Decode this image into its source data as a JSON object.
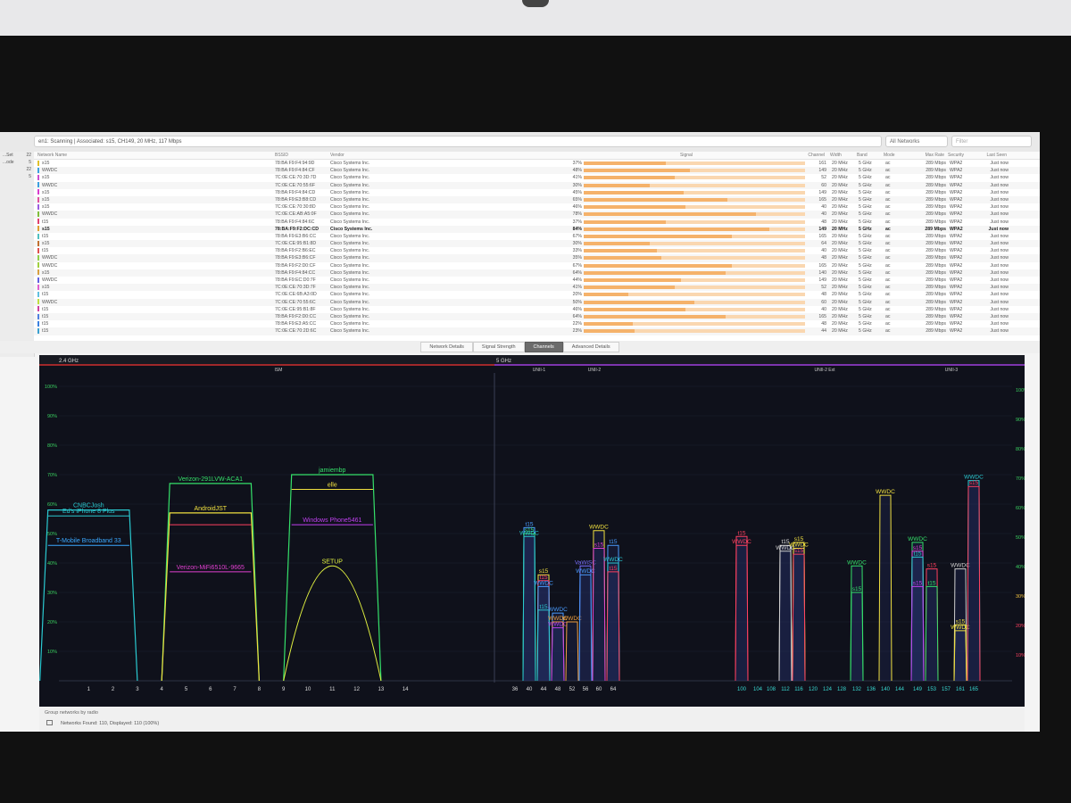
{
  "toolbar": {
    "status": "en1: Scanning | Associated: s15, CH149, 20 MHz, 117 Mbps",
    "filter": "All Networks",
    "search_placeholder": "Filter"
  },
  "sidebar": [
    {
      "label": "...Set",
      "count": "22"
    },
    {
      "label": "...ode",
      "count": "5"
    },
    {
      "label": "",
      "count": "22"
    },
    {
      "label": "",
      "count": "5"
    }
  ],
  "table": {
    "columns": [
      "Network Name",
      "BSSID",
      "Vendor",
      "Signal",
      "Channel",
      "Width",
      "Band",
      "Mode",
      "Max Rate",
      "Security",
      "Last Seen"
    ],
    "rows": [
      {
        "ssid": "s15",
        "color": "#e0c02a",
        "bssid": "78:BA:F9:F4:94:9D",
        "vendor": "Cisco Systems Inc.",
        "pct": "37%",
        "signal": 0.37,
        "channel": "161",
        "width": "20 MHz",
        "band": "5 GHz",
        "mode": "ac",
        "rate": "289 Mbps",
        "security": "WPA2",
        "seen": "Just now",
        "bold": false
      },
      {
        "ssid": "WWDC",
        "color": "#3aa0e0",
        "bssid": "78:BA:F9:F4:84:CF",
        "vendor": "Cisco Systems Inc.",
        "pct": "48%",
        "signal": 0.48,
        "channel": "149",
        "width": "20 MHz",
        "band": "5 GHz",
        "mode": "ac",
        "rate": "289 Mbps",
        "security": "WPA2",
        "seen": "Just now",
        "bold": false
      },
      {
        "ssid": "s15",
        "color": "#cc4fd0",
        "bssid": "7C:0E:CE:70:3D:7D",
        "vendor": "Cisco Systems Inc.",
        "pct": "41%",
        "signal": 0.41,
        "channel": "52",
        "width": "20 MHz",
        "band": "5 GHz",
        "mode": "ac",
        "rate": "289 Mbps",
        "security": "WPA2",
        "seen": "Just now",
        "bold": false
      },
      {
        "ssid": "WWDC",
        "color": "#3aa0e0",
        "bssid": "7C:0E:CE:70:55:6F",
        "vendor": "Cisco Systems Inc.",
        "pct": "30%",
        "signal": 0.3,
        "channel": "60",
        "width": "20 MHz",
        "band": "5 GHz",
        "mode": "ac",
        "rate": "289 Mbps",
        "security": "WPA2",
        "seen": "Just now",
        "bold": false
      },
      {
        "ssid": "s15",
        "color": "#d83bd0",
        "bssid": "78:BA:F9:F4:84:CD",
        "vendor": "Cisco Systems Inc.",
        "pct": "45%",
        "signal": 0.45,
        "channel": "149",
        "width": "20 MHz",
        "band": "5 GHz",
        "mode": "ac",
        "rate": "289 Mbps",
        "security": "WPA2",
        "seen": "Just now",
        "bold": false
      },
      {
        "ssid": "s15",
        "color": "#e050a0",
        "bssid": "78:BA:F9:E3:B8:CD",
        "vendor": "Cisco Systems Inc.",
        "pct": "65%",
        "signal": 0.65,
        "channel": "165",
        "width": "20 MHz",
        "band": "5 GHz",
        "mode": "ac",
        "rate": "289 Mbps",
        "security": "WPA2",
        "seen": "Just now",
        "bold": false
      },
      {
        "ssid": "s15",
        "color": "#9a5ce0",
        "bssid": "7C:0E:CE:70:30:8D",
        "vendor": "Cisco Systems Inc.",
        "pct": "46%",
        "signal": 0.46,
        "channel": "40",
        "width": "20 MHz",
        "band": "5 GHz",
        "mode": "ac",
        "rate": "289 Mbps",
        "security": "WPA2",
        "seen": "Just now",
        "bold": false
      },
      {
        "ssid": "WWDC",
        "color": "#7fbf3a",
        "bssid": "7C:0E:CE:AB:A5:0F",
        "vendor": "Cisco Systems Inc.",
        "pct": "78%",
        "signal": 0.78,
        "channel": "40",
        "width": "20 MHz",
        "band": "5 GHz",
        "mode": "ac",
        "rate": "289 Mbps",
        "security": "WPA2",
        "seen": "Just now",
        "bold": false
      },
      {
        "ssid": "t15",
        "color": "#e04070",
        "bssid": "78:BA:F9:F4:84:6C",
        "vendor": "Cisco Systems Inc.",
        "pct": "37%",
        "signal": 0.37,
        "channel": "48",
        "width": "20 MHz",
        "band": "5 GHz",
        "mode": "ac",
        "rate": "289 Mbps",
        "security": "WPA2",
        "seen": "Just now",
        "bold": false
      },
      {
        "ssid": "s15",
        "color": "#e0a030",
        "bssid": "78:BA:F9:F2:DC:CD",
        "vendor": "Cisco Systems Inc.",
        "pct": "84%",
        "signal": 0.84,
        "channel": "149",
        "width": "20 MHz",
        "band": "5 GHz",
        "mode": "ac",
        "rate": "289 Mbps",
        "security": "WPA2",
        "seen": "Just now",
        "bold": true
      },
      {
        "ssid": "t15",
        "color": "#50c0c0",
        "bssid": "78:BA:F9:E3:B6:CC",
        "vendor": "Cisco Systems Inc.",
        "pct": "67%",
        "signal": 0.67,
        "channel": "165",
        "width": "20 MHz",
        "band": "5 GHz",
        "mode": "ac",
        "rate": "289 Mbps",
        "security": "WPA2",
        "seen": "Just now",
        "bold": false
      },
      {
        "ssid": "s15",
        "color": "#c07030",
        "bssid": "7C:0E:CE:95:B1:8D",
        "vendor": "Cisco Systems Inc.",
        "pct": "30%",
        "signal": 0.3,
        "channel": "64",
        "width": "20 MHz",
        "band": "5 GHz",
        "mode": "ac",
        "rate": "289 Mbps",
        "security": "WPA2",
        "seen": "Just now",
        "bold": false
      },
      {
        "ssid": "t15",
        "color": "#e05050",
        "bssid": "78:BA:F9:F2:B6:EC",
        "vendor": "Cisco Systems Inc.",
        "pct": "33%",
        "signal": 0.33,
        "channel": "40",
        "width": "20 MHz",
        "band": "5 GHz",
        "mode": "ac",
        "rate": "289 Mbps",
        "security": "WPA2",
        "seen": "Just now",
        "bold": false
      },
      {
        "ssid": "WWDC",
        "color": "#8fd04a",
        "bssid": "78:BA:F9:E3:B6:CF",
        "vendor": "Cisco Systems Inc.",
        "pct": "35%",
        "signal": 0.35,
        "channel": "48",
        "width": "20 MHz",
        "band": "5 GHz",
        "mode": "ac",
        "rate": "289 Mbps",
        "security": "WPA2",
        "seen": "Just now",
        "bold": false
      },
      {
        "ssid": "WWDC",
        "color": "#a0d040",
        "bssid": "78:BA:F9:F2:D0:CF",
        "vendor": "Cisco Systems Inc.",
        "pct": "67%",
        "signal": 0.67,
        "channel": "165",
        "width": "20 MHz",
        "band": "5 GHz",
        "mode": "ac",
        "rate": "289 Mbps",
        "security": "WPA2",
        "seen": "Just now",
        "bold": false
      },
      {
        "ssid": "s15",
        "color": "#d8a040",
        "bssid": "78:BA:F9:F4:84:CC",
        "vendor": "Cisco Systems Inc.",
        "pct": "64%",
        "signal": 0.64,
        "channel": "140",
        "width": "20 MHz",
        "band": "5 GHz",
        "mode": "ac",
        "rate": "289 Mbps",
        "security": "WPA2",
        "seen": "Just now",
        "bold": false
      },
      {
        "ssid": "WWDC",
        "color": "#6060e0",
        "bssid": "78:BA:F9:EC:D0:7F",
        "vendor": "Cisco Systems Inc.",
        "pct": "44%",
        "signal": 0.44,
        "channel": "149",
        "width": "20 MHz",
        "band": "5 GHz",
        "mode": "ac",
        "rate": "289 Mbps",
        "security": "WPA2",
        "seen": "Just now",
        "bold": false
      },
      {
        "ssid": "s15",
        "color": "#e060d0",
        "bssid": "7C:0E:CE:70:3D:7F",
        "vendor": "Cisco Systems Inc.",
        "pct": "41%",
        "signal": 0.41,
        "channel": "52",
        "width": "20 MHz",
        "band": "5 GHz",
        "mode": "ac",
        "rate": "289 Mbps",
        "security": "WPA2",
        "seen": "Just now",
        "bold": false
      },
      {
        "ssid": "t15",
        "color": "#60c0e0",
        "bssid": "7C:0E:CE:6B:A3:0D",
        "vendor": "Cisco Systems Inc.",
        "pct": "20%",
        "signal": 0.2,
        "channel": "48",
        "width": "20 MHz",
        "band": "5 GHz",
        "mode": "ac",
        "rate": "289 Mbps",
        "security": "WPA2",
        "seen": "Just now",
        "bold": false
      },
      {
        "ssid": "WWDC",
        "color": "#c0e040",
        "bssid": "7C:0E:CE:70:55:6C",
        "vendor": "Cisco Systems Inc.",
        "pct": "50%",
        "signal": 0.5,
        "channel": "60",
        "width": "20 MHz",
        "band": "5 GHz",
        "mode": "ac",
        "rate": "289 Mbps",
        "security": "WPA2",
        "seen": "Just now",
        "bold": false
      },
      {
        "ssid": "t15",
        "color": "#d040a0",
        "bssid": "7C:0E:CE:95:B1:8F",
        "vendor": "Cisco Systems Inc.",
        "pct": "46%",
        "signal": 0.46,
        "channel": "40",
        "width": "20 MHz",
        "band": "5 GHz",
        "mode": "ac",
        "rate": "289 Mbps",
        "security": "WPA2",
        "seen": "Just now",
        "bold": false
      },
      {
        "ssid": "t15",
        "color": "#5080e0",
        "bssid": "78:BA:F9:F2:D0:CC",
        "vendor": "Cisco Systems Inc.",
        "pct": "64%",
        "signal": 0.64,
        "channel": "165",
        "width": "20 MHz",
        "band": "5 GHz",
        "mode": "ac",
        "rate": "289 Mbps",
        "security": "WPA2",
        "seen": "Just now",
        "bold": false
      },
      {
        "ssid": "t15",
        "color": "#3a80e0",
        "bssid": "78:BA:F9:E3:A5:CC",
        "vendor": "Cisco Systems Inc.",
        "pct": "22%",
        "signal": 0.22,
        "channel": "48",
        "width": "20 MHz",
        "band": "5 GHz",
        "mode": "ac",
        "rate": "289 Mbps",
        "security": "WPA2",
        "seen": "Just now",
        "bold": false
      },
      {
        "ssid": "t15",
        "color": "#3aa0d0",
        "bssid": "7C:0E:CE:70:2D:6C",
        "vendor": "Cisco Systems Inc.",
        "pct": "23%",
        "signal": 0.23,
        "channel": "44",
        "width": "20 MHz",
        "band": "5 GHz",
        "mode": "ac",
        "rate": "289 Mbps",
        "security": "WPA2",
        "seen": "Just now",
        "bold": false
      }
    ]
  },
  "tabs": [
    "Network Details",
    "Signal Strength",
    "Channels",
    "Advanced Details"
  ],
  "active_tab": "Channels",
  "chart_data": [
    {
      "type": "area",
      "title": "2.4 GHz",
      "band_label": "ISM",
      "x_ticks": [
        "1",
        "2",
        "3",
        "4",
        "5",
        "6",
        "7",
        "8",
        "9",
        "10",
        "11",
        "12",
        "13",
        "14"
      ],
      "y_ticks": [
        "100%",
        "90%",
        "80%",
        "70%",
        "60%",
        "50%",
        "40%",
        "30%",
        "20%",
        "10%"
      ],
      "ylim": [
        0,
        100
      ],
      "series": [
        {
          "name": "CNBCJosh",
          "color": "#2ac9d0",
          "from": -1,
          "to": 3,
          "value": 58,
          "shape": "trap"
        },
        {
          "name": "Ed's iPhone 8 Plus",
          "color": "#2ac9d0",
          "from": -1,
          "to": 3,
          "value": 56,
          "shape": "line"
        },
        {
          "name": "T-Mobile Broadband 33",
          "color": "#3aa8ff",
          "from": -1,
          "to": 3,
          "value": 46,
          "shape": "line"
        },
        {
          "name": "Verizon-291LVW-ACA1",
          "color": "#35e06a",
          "from": 4,
          "to": 8,
          "value": 67,
          "shape": "trap"
        },
        {
          "name": "AndroidJST",
          "color": "#f0e040",
          "from": 4,
          "to": 8,
          "value": 57,
          "shape": "trap"
        },
        {
          "name": "",
          "color": "#ff4060",
          "from": 4,
          "to": 8,
          "value": 53,
          "shape": "line"
        },
        {
          "name": "Verizon-MiFi6510L-9665",
          "color": "#e040d0",
          "from": 4,
          "to": 8,
          "value": 37,
          "shape": "line"
        },
        {
          "name": "jamiembp",
          "color": "#35e06a",
          "from": 9,
          "to": 13,
          "value": 70,
          "shape": "trap"
        },
        {
          "name": "elle",
          "color": "#f0e040",
          "from": 9,
          "to": 13,
          "value": 65,
          "shape": "line"
        },
        {
          "name": "Windows Phone5461",
          "color": "#c040f0",
          "from": 9,
          "to": 13,
          "value": 53,
          "shape": "line"
        },
        {
          "name": "SETUP",
          "color": "#e0f040",
          "from": 9,
          "to": 13,
          "value": 39,
          "shape": "arc"
        }
      ]
    },
    {
      "type": "bar",
      "title": "5 GHz",
      "bands": [
        "UNII-1",
        "UNII-2",
        "UNII-2 Ext",
        "UNII-3"
      ],
      "x_ticks": [
        "36",
        "40",
        "44",
        "48",
        "52",
        "56",
        "60",
        "64",
        "100",
        "104",
        "108",
        "112",
        "116",
        "120",
        "124",
        "128",
        "132",
        "136",
        "140",
        "144",
        "149",
        "153",
        "157",
        "161",
        "165"
      ],
      "y_ticks": [
        "100%",
        "90%",
        "80%",
        "70%",
        "60%",
        "50%",
        "40%",
        "30%",
        "20%",
        "10%"
      ],
      "ylim": [
        0,
        100
      ],
      "series": [
        {
          "name": "t15",
          "channel": "40",
          "value": 52,
          "color": "#4a9cff"
        },
        {
          "name": "s15",
          "channel": "40",
          "value": 50,
          "color": "#35e06a"
        },
        {
          "name": "WWDC",
          "channel": "40",
          "value": 49,
          "color": "#2ac9d0"
        },
        {
          "name": "s15",
          "channel": "44",
          "value": 36,
          "color": "#f0e040"
        },
        {
          "name": "t15",
          "channel": "44",
          "value": 34,
          "color": "#ff4060"
        },
        {
          "name": "WWDC",
          "channel": "44",
          "value": 32,
          "color": "#4a9cff"
        },
        {
          "name": "t15",
          "channel": "44",
          "value": 24,
          "color": "#2ac9d0"
        },
        {
          "name": "WWDC",
          "channel": "48",
          "value": 23,
          "color": "#4a9cff"
        },
        {
          "name": "WWDC",
          "channel": "48",
          "value": 20,
          "color": "#f0a040"
        },
        {
          "name": "WWDC",
          "channel": "48",
          "value": 18,
          "color": "#c040f0"
        },
        {
          "name": "WWDC",
          "channel": "52",
          "value": 20,
          "color": "#f0a040"
        },
        {
          "name": "VaWiSC",
          "channel": "56",
          "value": 39,
          "color": "#7a70ff"
        },
        {
          "name": "WWDC",
          "channel": "56",
          "value": 36,
          "color": "#4a9cff"
        },
        {
          "name": "WWDC",
          "channel": "60",
          "value": 51,
          "color": "#f0e040"
        },
        {
          "name": "s15",
          "channel": "60",
          "value": 45,
          "color": "#e040d0"
        },
        {
          "name": "t15",
          "channel": "64",
          "value": 46,
          "color": "#4a9cff"
        },
        {
          "name": "WWDC",
          "channel": "64",
          "value": 40,
          "color": "#2ac9d0"
        },
        {
          "name": "t15",
          "channel": "64",
          "value": 37,
          "color": "#ff4060"
        },
        {
          "name": "t15",
          "channel": "100",
          "value": 49,
          "color": "#ff4060"
        },
        {
          "name": "WWDC",
          "channel": "100",
          "value": 46,
          "color": "#ff4060"
        },
        {
          "name": "t15",
          "channel": "112",
          "value": 46,
          "color": "#e0e0e0"
        },
        {
          "name": "WWDC",
          "channel": "112",
          "value": 44,
          "color": "#d0d0d0"
        },
        {
          "name": "s15",
          "channel": "116",
          "value": 47,
          "color": "#f0e040"
        },
        {
          "name": "WWDC",
          "channel": "116",
          "value": 45,
          "color": "#f0e040"
        },
        {
          "name": "s15",
          "channel": "116",
          "value": 43,
          "color": "#ff4060"
        },
        {
          "name": "WWDC",
          "channel": "132",
          "value": 39,
          "color": "#35e06a"
        },
        {
          "name": "s15",
          "channel": "132",
          "value": 30,
          "color": "#35e06a"
        },
        {
          "name": "WWDC",
          "channel": "140",
          "value": 63,
          "color": "#f0e040"
        },
        {
          "name": "WWDC",
          "channel": "149",
          "value": 47,
          "color": "#35e06a"
        },
        {
          "name": "s15",
          "channel": "149",
          "value": 44,
          "color": "#e040d0"
        },
        {
          "name": "t15",
          "channel": "149",
          "value": 42,
          "color": "#2ac9d0"
        },
        {
          "name": "s15",
          "channel": "153",
          "value": 38,
          "color": "#ff4060"
        },
        {
          "name": "s15",
          "channel": "149",
          "value": 32,
          "color": "#c040f0"
        },
        {
          "name": "t15",
          "channel": "153",
          "value": 32,
          "color": "#35e06a"
        },
        {
          "name": "WWDC",
          "channel": "161",
          "value": 38,
          "color": "#d0d0d0"
        },
        {
          "name": "s15",
          "channel": "161",
          "value": 19,
          "color": "#f0e040"
        },
        {
          "name": "WWDC",
          "channel": "161",
          "value": 17,
          "color": "#f0e040"
        },
        {
          "name": "WWDC",
          "channel": "165",
          "value": 68,
          "color": "#2ac9d0"
        },
        {
          "name": "s15",
          "channel": "165",
          "value": 66,
          "color": "#ff4060"
        }
      ]
    }
  ],
  "footer": {
    "group_label": "Group networks by radio",
    "found": "Networks Found: 110, Displayed: 110 (100%)"
  }
}
